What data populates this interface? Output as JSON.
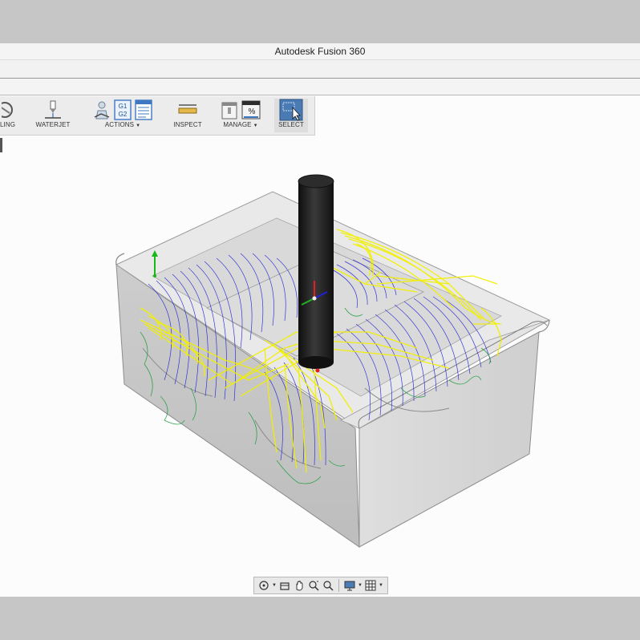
{
  "window": {
    "title": "Autodesk Fusion 360"
  },
  "toolbar": {
    "items": [
      {
        "label": "LING",
        "icon": "milling-icon"
      },
      {
        "label": "WATERJET",
        "icon": "waterjet-icon"
      },
      {
        "label": "ACTIONS",
        "icon": "actions-icon",
        "has_dropdown": true,
        "gcode_text": "G1 G2"
      },
      {
        "label": "INSPECT",
        "icon": "measure-icon"
      },
      {
        "label": "MANAGE",
        "icon": "manage-icon",
        "has_dropdown": true,
        "percent_text": "%"
      },
      {
        "label": "SELECT",
        "icon": "select-icon",
        "selected": true
      }
    ]
  },
  "colors": {
    "toolpath_rapid": "#f2f000",
    "toolpath_cut": "#1a1ad2",
    "toolpath_lead": "#1e9e3c",
    "stock": "#d4d4d4",
    "tool": "#1b1b1b"
  },
  "navbar": {
    "items": [
      "orbit-icon",
      "look-at-icon",
      "pan-icon",
      "zoom-window-icon",
      "fit-icon",
      "display-settings-icon",
      "grid-settings-icon"
    ]
  }
}
